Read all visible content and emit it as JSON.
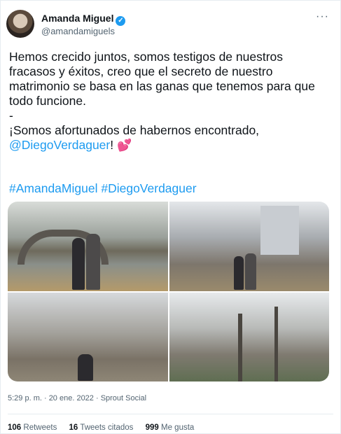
{
  "tweet": {
    "author_name": "Amanda Miguel",
    "author_handle": "@amandamiguels",
    "verified_icon": "✓",
    "more_icon": "···",
    "body_paragraph_1": "Hemos crecido juntos, somos testigos de nuestros fracasos y éxitos, creo que el secreto de nuestro matrimonio se basa en las ganas que tenemos para que todo funcione.",
    "body_dash": "-",
    "body_paragraph_2_prefix": "¡Somos afortunados de habernos encontrado,",
    "mention": "@DiegoVerdaguer",
    "mention_suffix": "!",
    "heart_emoji": "💕",
    "hashtag_1": "#AmandaMiguel",
    "hashtag_2": "#DiegoVerdaguer",
    "meta": "5:29 p. m. · 20 ene. 2022 · Sprout Social",
    "stats": {
      "retweets_count": "106",
      "retweets_label": "Retweets",
      "quotes_count": "16",
      "quotes_label": "Tweets citados",
      "likes_count": "999",
      "likes_label": "Me gusta"
    }
  },
  "colors": {
    "link": "#1d9bf0",
    "text": "#0f1419",
    "secondary": "#536471",
    "heart": "#e0245e"
  }
}
